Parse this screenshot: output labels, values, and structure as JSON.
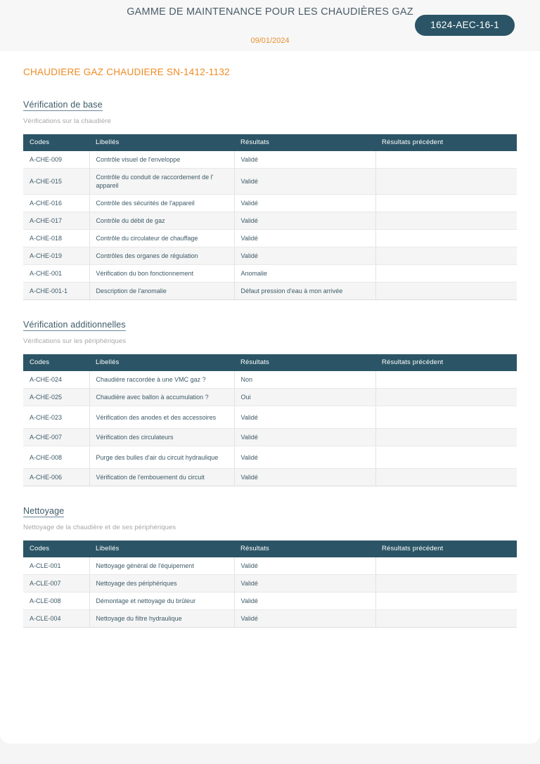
{
  "header": {
    "title": "GAMME DE MAINTENANCE POUR LES CHAUDIÈRES GAZ",
    "date": "09/01/2024",
    "badge": "1624-AEC-16-1"
  },
  "equipment": {
    "title": "CHAUDIERE GAZ CHAUDIERE SN-1412-1132"
  },
  "colors": {
    "accent_orange": "#ef8b24",
    "dark_teal": "#2b5566",
    "heading_blue": "#3d5a68",
    "band_gray": "#f7f7f8",
    "row_alt": "#f5f5f5"
  },
  "table_columns": [
    "Codes",
    "Libellés",
    "Résultats",
    "Résultats précédent"
  ],
  "sections": [
    {
      "heading": "Vérification de base",
      "subtitle": "Vérifications sur la chaudière",
      "rows": [
        {
          "code": "A-CHE-009",
          "label": "Contrôle visuel de l'enveloppe",
          "result": "Validé",
          "previous": "",
          "tall": false
        },
        {
          "code": "A-CHE-015",
          "label": "Contrôle du conduit de raccordement de l' appareil",
          "result": "Validé",
          "previous": "",
          "tall": true
        },
        {
          "code": "A-CHE-016",
          "label": "Contrôle des sécurités de l'appareil",
          "result": "Validé",
          "previous": "",
          "tall": false
        },
        {
          "code": "A-CHE-017",
          "label": "Contrôle du débit de gaz",
          "result": "Validé",
          "previous": "",
          "tall": false
        },
        {
          "code": "A-CHE-018",
          "label": "Contrôle du circulateur de chauffage",
          "result": "Validé",
          "previous": "",
          "tall": false
        },
        {
          "code": "A-CHE-019",
          "label": "Contrôles des organes de régulation",
          "result": "Validé",
          "previous": "",
          "tall": false
        },
        {
          "code": "A-CHE-001",
          "label": "Vérification du bon fonctionnement",
          "result": "Anomalie",
          "previous": "",
          "tall": false
        },
        {
          "code": "A-CHE-001-1",
          "label": "Description de l'anomalie",
          "result": "Défaut pression d'eau à mon arrivée",
          "previous": "",
          "tall": false
        }
      ]
    },
    {
      "heading": "Vérification additionnelles",
      "subtitle": "Vérifications sur les périphériques",
      "rows": [
        {
          "code": "A-CHE-024",
          "label": "Chaudière raccordée à une VMC gaz ?",
          "result": "Non",
          "previous": "",
          "tall": false
        },
        {
          "code": "A-CHE-025",
          "label": "Chaudière avec ballon à accumulation ?",
          "result": "Oui",
          "previous": "",
          "tall": false
        },
        {
          "code": "A-CHE-023",
          "label": "Vérification des anodes et des accessoires",
          "result": "Validé",
          "previous": "",
          "tall": true
        },
        {
          "code": "A-CHE-007",
          "label": "Vérification des circulateurs",
          "result": "Validé",
          "previous": "",
          "tall": false
        },
        {
          "code": "A-CHE-008",
          "label": "Purge des bulles d'air du circuit hydraulique",
          "result": "Validé",
          "previous": "",
          "tall": true
        },
        {
          "code": "A-CHE-006",
          "label": "Vérification de l'embouement du circuit",
          "result": "Validé",
          "previous": "",
          "tall": false
        }
      ]
    },
    {
      "heading": "Nettoyage",
      "subtitle": "Nettoyage de la chaudière et de ses périphériques",
      "rows": [
        {
          "code": "A-CLE-001",
          "label": "Nettoyage général de l'équipement",
          "result": "Validé",
          "previous": "",
          "tall": false
        },
        {
          "code": "A-CLE-007",
          "label": "Nettoyage des périphériques",
          "result": "Validé",
          "previous": "",
          "tall": false
        },
        {
          "code": "A-CLE-008",
          "label": "Démontage et nettoyage du brûleur",
          "result": "Validé",
          "previous": "",
          "tall": false
        },
        {
          "code": "A-CLE-004",
          "label": "Nettoyage du filtre hydraulique",
          "result": "Validé",
          "previous": "",
          "tall": false
        }
      ]
    }
  ]
}
